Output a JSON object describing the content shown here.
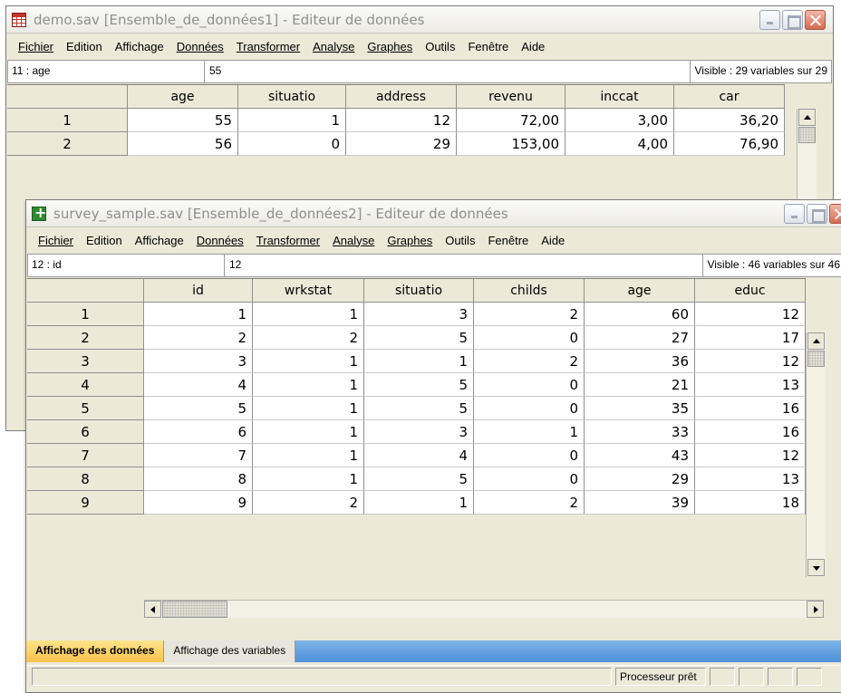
{
  "win1": {
    "title": "demo.sav [Ensemble_de_données1] - Editeur de données",
    "menu": [
      "Fichier",
      "Edition",
      "Affichage",
      "Données",
      "Transformer",
      "Analyse",
      "Graphes",
      "Outils",
      "Fenêtre",
      "Aide"
    ],
    "cell_ref": "11 : age",
    "cell_value": "55",
    "visible_info": "Visible : 29 variables sur 29",
    "columns": [
      "age",
      "situatio",
      "address",
      "revenu",
      "inccat",
      "car"
    ],
    "rows": [
      {
        "n": "1",
        "cells": [
          "55",
          "1",
          "12",
          "72,00",
          "3,00",
          "36,20"
        ]
      },
      {
        "n": "2",
        "cells": [
          "56",
          "0",
          "29",
          "153,00",
          "4,00",
          "76,90"
        ]
      }
    ]
  },
  "win2": {
    "title": "survey_sample.sav [Ensemble_de_données2] - Editeur de données",
    "menu": [
      "Fichier",
      "Edition",
      "Affichage",
      "Données",
      "Transformer",
      "Analyse",
      "Graphes",
      "Outils",
      "Fenêtre",
      "Aide"
    ],
    "cell_ref": "12 : id",
    "cell_value": "12",
    "visible_info": "Visible : 46 variables sur 46",
    "columns": [
      "id",
      "wrkstat",
      "situatio",
      "childs",
      "age",
      "educ"
    ],
    "rows": [
      {
        "n": "1",
        "cells": [
          "1",
          "1",
          "3",
          "2",
          "60",
          "12"
        ]
      },
      {
        "n": "2",
        "cells": [
          "2",
          "2",
          "5",
          "0",
          "27",
          "17"
        ]
      },
      {
        "n": "3",
        "cells": [
          "3",
          "1",
          "1",
          "2",
          "36",
          "12"
        ]
      },
      {
        "n": "4",
        "cells": [
          "4",
          "1",
          "5",
          "0",
          "21",
          "13"
        ]
      },
      {
        "n": "5",
        "cells": [
          "5",
          "1",
          "5",
          "0",
          "35",
          "16"
        ]
      },
      {
        "n": "6",
        "cells": [
          "6",
          "1",
          "3",
          "1",
          "33",
          "16"
        ]
      },
      {
        "n": "7",
        "cells": [
          "7",
          "1",
          "4",
          "0",
          "43",
          "12"
        ]
      },
      {
        "n": "8",
        "cells": [
          "8",
          "1",
          "5",
          "0",
          "29",
          "13"
        ]
      },
      {
        "n": "9",
        "cells": [
          "9",
          "2",
          "1",
          "2",
          "39",
          "18"
        ]
      }
    ],
    "tabs": [
      "Affichage des données",
      "Affichage des variables"
    ],
    "status": "Processeur prêt"
  },
  "colors": {
    "active_tab": "#f8c34b",
    "tabstrip": "#4c8fd8",
    "chrome": "#ece9d8",
    "close_button": "#d46a52"
  },
  "icons": [
    "data-editor-icon",
    "minimize-icon",
    "maximize-icon",
    "close-icon",
    "scroll-up-icon",
    "scroll-down-icon",
    "scroll-left-icon",
    "scroll-right-icon"
  ]
}
